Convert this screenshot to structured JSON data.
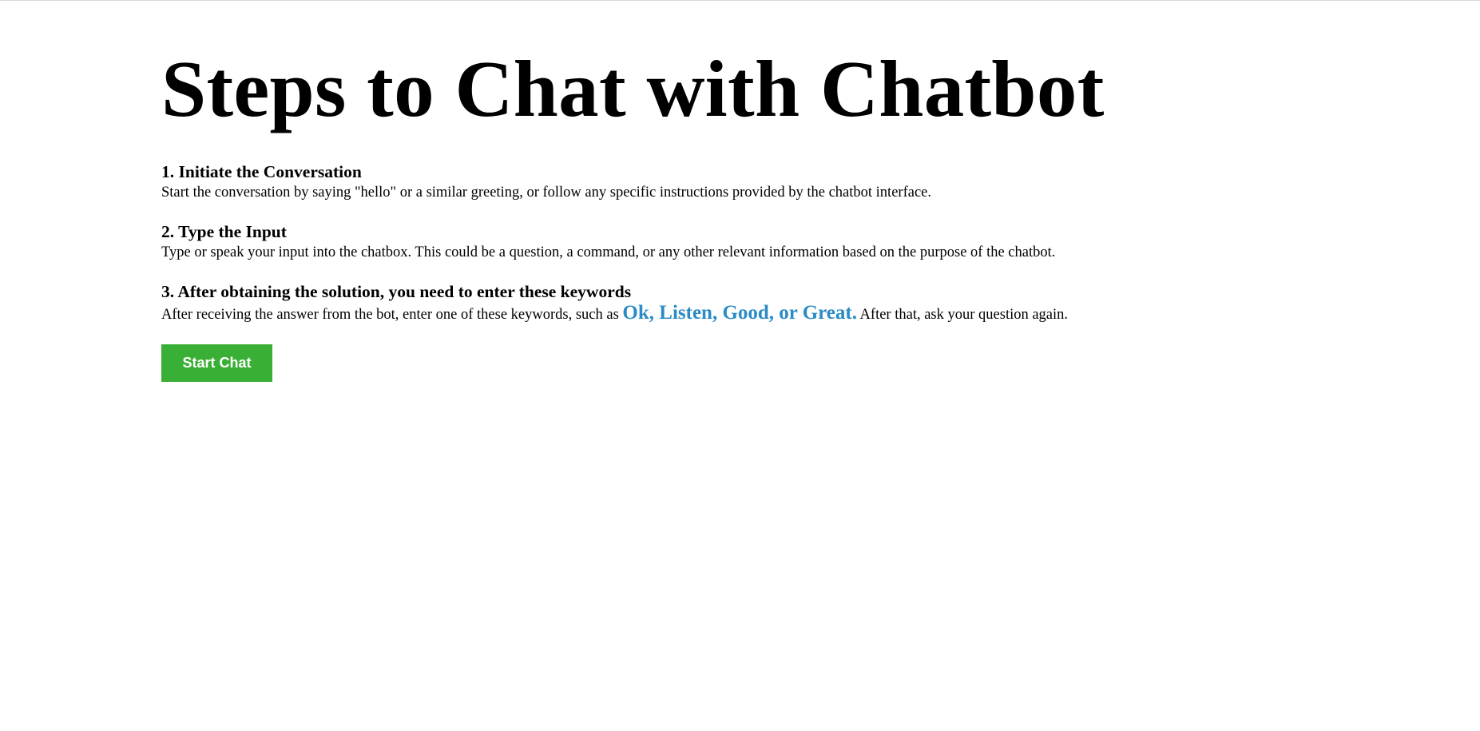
{
  "page": {
    "title": "Steps to Chat with Chatbot"
  },
  "steps": [
    {
      "heading": "1. Initiate the Conversation",
      "text": "Start the conversation by saying \"hello\" or a similar greeting, or follow any specific instructions provided by the chatbot interface."
    },
    {
      "heading": "2. Type the Input",
      "text": "Type or speak your input into the chatbox. This could be a question, a command, or any other relevant information based on the purpose of the chatbot."
    },
    {
      "heading": "3. After obtaining the solution, you need to enter these keywords",
      "text_before": "After receiving the answer from the bot, enter one of these keywords, such as ",
      "keywords": "Ok, Listen, Good, or Great.",
      "text_after": " After that, ask your question again."
    }
  ],
  "actions": {
    "start_chat_label": "Start Chat"
  },
  "colors": {
    "keyword_accent": "#2a8bc6",
    "button_bg": "#3aaf35",
    "button_text": "#ffffff"
  }
}
